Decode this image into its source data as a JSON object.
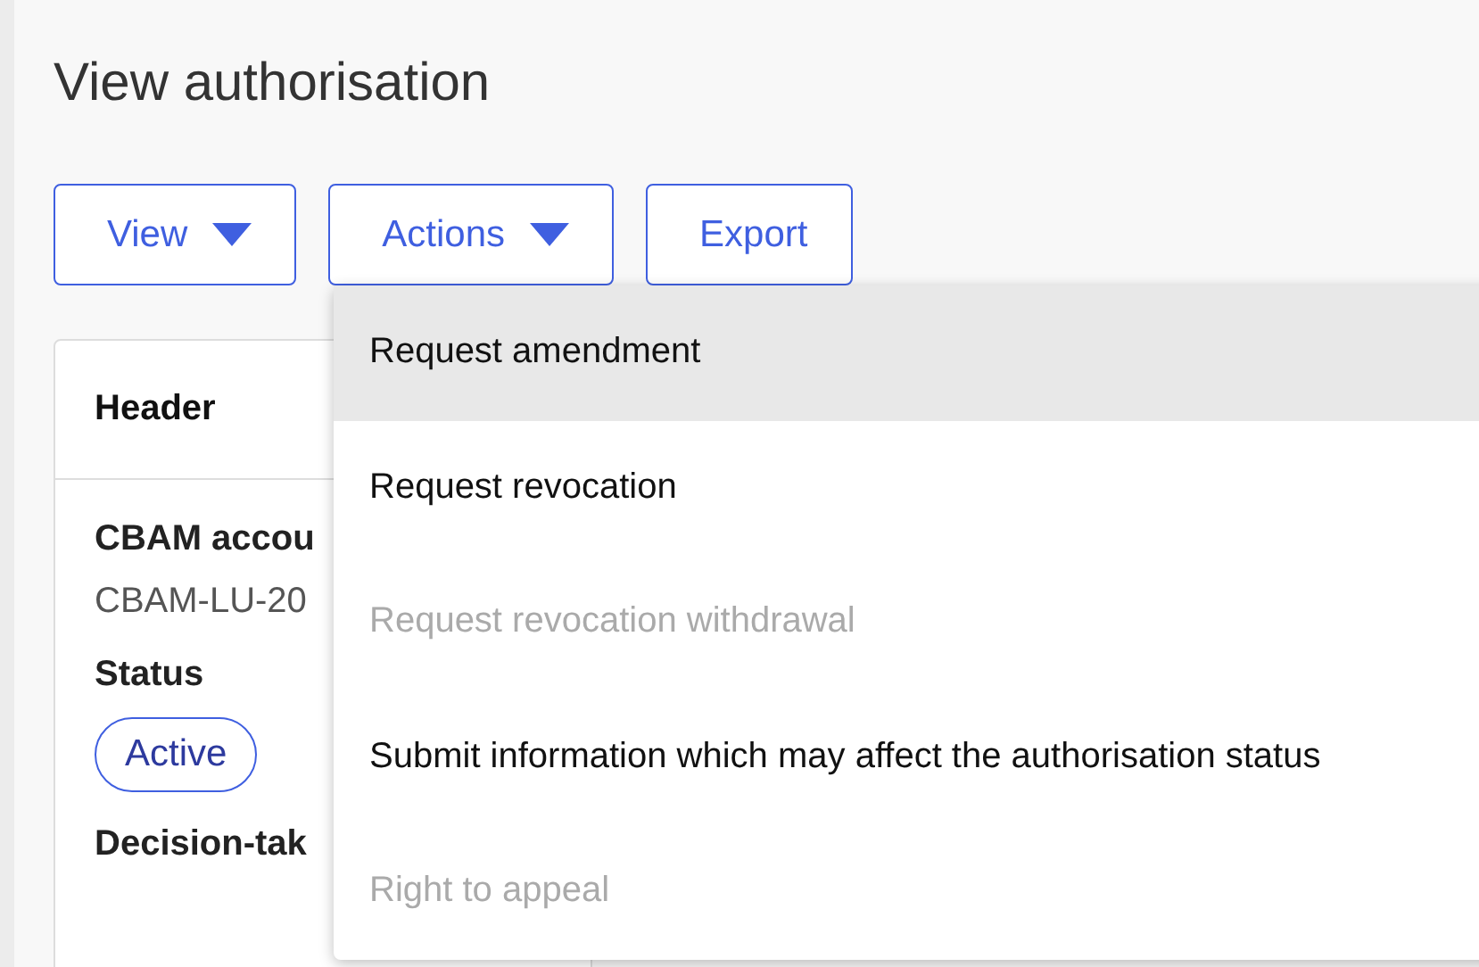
{
  "page": {
    "title": "View authorisation"
  },
  "toolbar": [
    {
      "label": "View",
      "kind": "dropdown"
    },
    {
      "label": "Actions",
      "kind": "dropdown"
    },
    {
      "label": "Export",
      "kind": "plain"
    }
  ],
  "card": {
    "header": "Header",
    "fields": [
      {
        "kind": "text",
        "label": "CBAM accou",
        "value": "CBAM-LU-20"
      },
      {
        "kind": "pill",
        "label": "Status",
        "value": "Active"
      },
      {
        "kind": "label",
        "label": "Decision-tak"
      }
    ]
  },
  "actions_menu": {
    "items": [
      {
        "label": "Request amendment",
        "highlighted": true,
        "disabled": false
      },
      {
        "label": "Request revocation",
        "highlighted": false,
        "disabled": false
      },
      {
        "label": "Request revocation withdrawal",
        "highlighted": false,
        "disabled": true
      },
      {
        "label": "Submit information which may affect the authorisation status",
        "highlighted": false,
        "disabled": false
      },
      {
        "label": "Right to appeal",
        "highlighted": false,
        "disabled": true
      }
    ]
  }
}
